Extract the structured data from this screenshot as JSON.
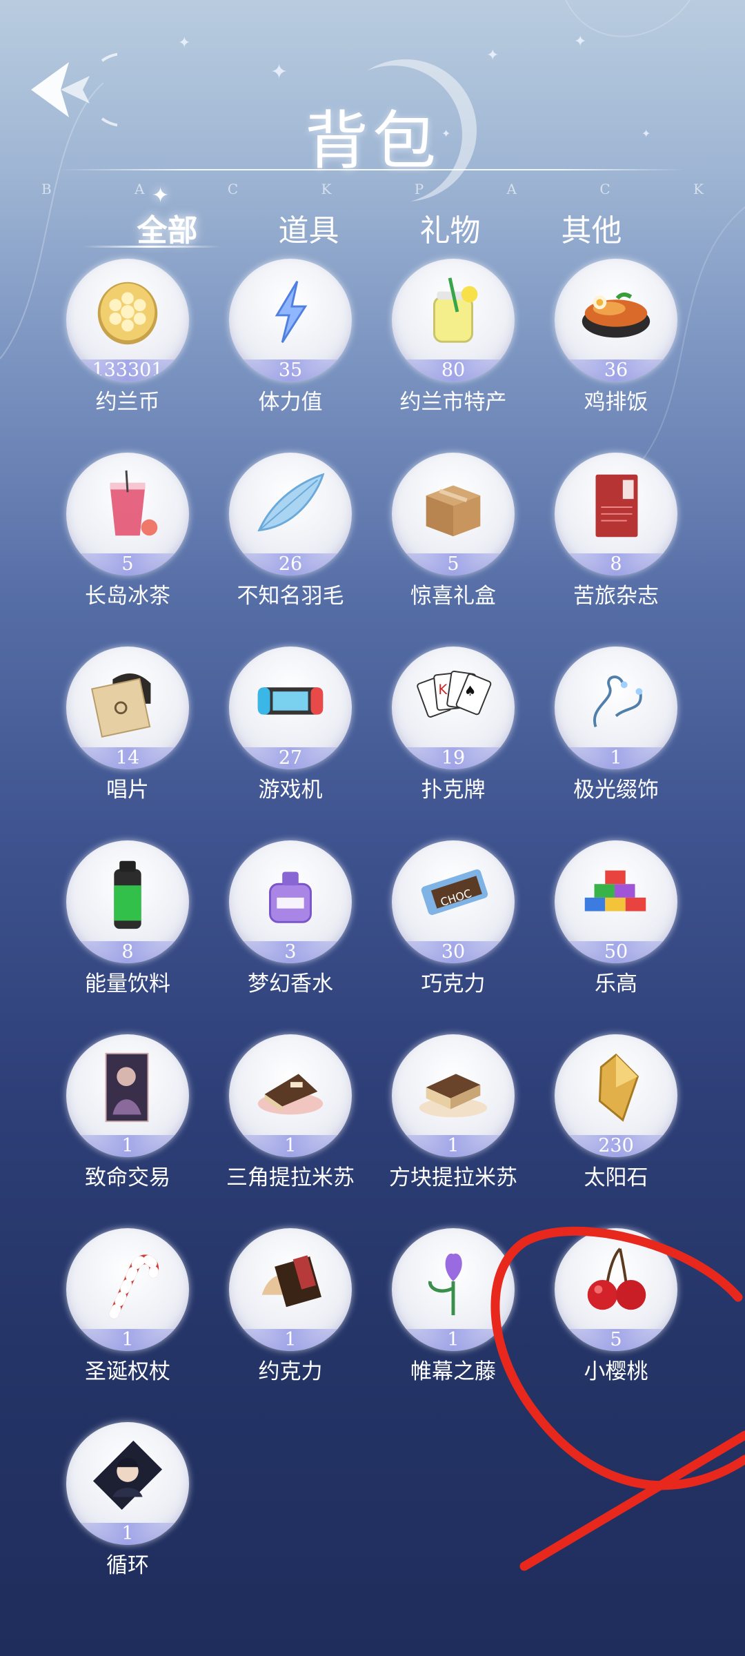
{
  "header": {
    "title": "背包",
    "subtitle_letters": [
      "B",
      "A",
      "C",
      "K",
      "P",
      "A",
      "C",
      "K"
    ]
  },
  "tabs": [
    {
      "label": "全部",
      "active": true
    },
    {
      "label": "道具",
      "active": false
    },
    {
      "label": "礼物",
      "active": false
    },
    {
      "label": "其他",
      "active": false
    }
  ],
  "items": [
    {
      "name": "约兰币",
      "count": "133301",
      "icon": "coin-icon"
    },
    {
      "name": "体力值",
      "count": "35",
      "icon": "lightning-icon"
    },
    {
      "name": "约兰市特产",
      "count": "80",
      "icon": "lemonade-jar-icon"
    },
    {
      "name": "鸡排饭",
      "count": "36",
      "icon": "chicken-rice-bowl-icon"
    },
    {
      "name": "长岛冰茶",
      "count": "5",
      "icon": "iced-tea-icon"
    },
    {
      "name": "不知名羽毛",
      "count": "26",
      "icon": "feather-icon"
    },
    {
      "name": "惊喜礼盒",
      "count": "5",
      "icon": "gift-box-icon"
    },
    {
      "name": "苦旅杂志",
      "count": "8",
      "icon": "magazine-icon"
    },
    {
      "name": "唱片",
      "count": "14",
      "icon": "record-icon"
    },
    {
      "name": "游戏机",
      "count": "27",
      "icon": "game-console-icon"
    },
    {
      "name": "扑克牌",
      "count": "19",
      "icon": "playing-cards-icon"
    },
    {
      "name": "极光缀饰",
      "count": "1",
      "icon": "earrings-icon"
    },
    {
      "name": "能量饮料",
      "count": "8",
      "icon": "energy-drink-icon"
    },
    {
      "name": "梦幻香水",
      "count": "3",
      "icon": "perfume-icon"
    },
    {
      "name": "巧克力",
      "count": "30",
      "icon": "chocolate-bar-icon"
    },
    {
      "name": "乐高",
      "count": "50",
      "icon": "lego-bricks-icon"
    },
    {
      "name": "致命交易",
      "count": "1",
      "icon": "poster-card-icon"
    },
    {
      "name": "三角提拉米苏",
      "count": "1",
      "icon": "tiramisu-slice-icon"
    },
    {
      "name": "方块提拉米苏",
      "count": "1",
      "icon": "tiramisu-square-icon"
    },
    {
      "name": "太阳石",
      "count": "230",
      "icon": "sunstone-crystal-icon"
    },
    {
      "name": "圣诞权杖",
      "count": "1",
      "icon": "candy-cane-icon"
    },
    {
      "name": "约克力",
      "count": "1",
      "icon": "chocolate-shell-icon"
    },
    {
      "name": "帷幕之藤",
      "count": "1",
      "icon": "purple-flower-icon"
    },
    {
      "name": "小樱桃",
      "count": "5",
      "icon": "cherry-icon"
    },
    {
      "name": "循环",
      "count": "1",
      "icon": "portrait-icon"
    }
  ],
  "colors": {
    "annotation": "#e8281c",
    "count_band": "#9aa0e6",
    "text": "#ffffff"
  }
}
